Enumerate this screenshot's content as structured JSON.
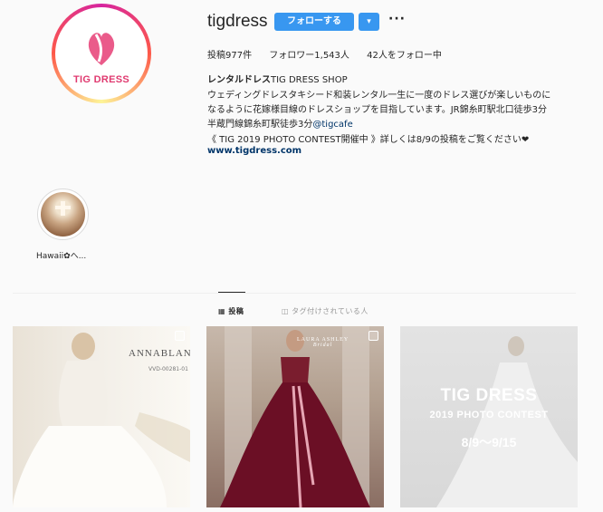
{
  "profile": {
    "username": "tigdress",
    "follow_label": "フォローする",
    "dropdown_label": "▾",
    "more_label": "···",
    "avatar_logo_text": "TIG DRESS"
  },
  "stats": {
    "posts": "投稿977件",
    "followers": "フォロワー1,543人",
    "following": "42人をフォロー中"
  },
  "bio": {
    "name_bold": "レンタルドレス",
    "name_rest": "TIG DRESS SHOP",
    "line1": "ウェディングドレスタキシード和装レンタル一生に一度のドレス選びが楽しいものに",
    "line2": "なるように花嫁様目線のドレスショップを目指しています。JR錦糸町駅北口徒歩3分",
    "line3_text": "半蔵門線錦糸町駅徒歩3分",
    "line3_link": "@tigcafe",
    "line4": "《 TIG 2019 PHOTO CONTEST開催中 》詳しくは8/9の投稿をご覧ください❤",
    "website": "www.tigdress.com"
  },
  "highlights": [
    {
      "label": "Hawaii✿へ..."
    }
  ],
  "tabs": {
    "posts_label": "▦ 投稿",
    "tagged_label": "◫ タグ付けされている人"
  },
  "posts": [
    {
      "brand": "ANNABLANCA",
      "code": "VVD-00281-01"
    },
    {
      "brand": "LAURA ASHLEY",
      "brand_sub": "Bridal"
    },
    {
      "title": "TIG DRESS",
      "subtitle": "2019 PHOTO CONTEST",
      "date": "8/9～9/15"
    }
  ],
  "colors": {
    "accent": "#3897f0",
    "link": "#003569",
    "text": "#262626",
    "logo_pink": "#e03a70"
  }
}
